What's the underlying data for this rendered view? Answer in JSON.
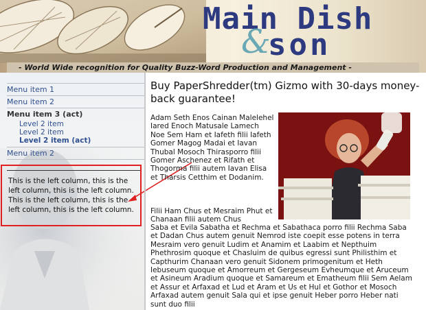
{
  "header": {
    "logo_line1": "Main Dish",
    "logo_amp": "&",
    "logo_line2": "son",
    "tagline": "- World Wide recognition for Quality Buzz-Word Production and Management -"
  },
  "menu": {
    "items": [
      {
        "label": "Menu item 1"
      },
      {
        "label": "Menu item 2"
      },
      {
        "label": "Menu item 3 (act)"
      }
    ],
    "sub_items": [
      {
        "label": "Level 2 item"
      },
      {
        "label": "Level 2 item"
      },
      {
        "label": "Level 2 item (act)"
      }
    ],
    "last_item": {
      "label": "Menu item 2"
    }
  },
  "left_column": {
    "text": "This is the left column, this is the left column, this is the left column. This is the left column, this is the left column, this is the left column."
  },
  "main": {
    "headline": "Buy PaperShredder(tm) Gizmo with 30-days money-back guarantee!",
    "para1": "Adam Seth Enos Cainan Malelehel Iared Enoch Matusale Lamech Noe Sem Ham et Iafeth filii Iafeth Gomer Magog Madai et Iavan Thubal Mosoch Thirasporro filii Gomer Aschenez et Rifath et Thogorma filii autem Iavan Elisa et Tharsis Cetthim et Dodanim.",
    "para2": "Filii Ham Chus et Mesraim Phut et Chanaan filii autem Chus",
    "para3": "Saba et Evila Sabatha et Rechma et Sabathaca porro filii Rechma Saba et Dadan Chus autem genuit Nemrod iste coepit esse potens in terra Mesraim vero genuit Ludim et Anamim et Laabim et Nepthuim Phethrosim quoque et Chasluim de quibus egressi sunt Philisthim et Capthurim Chanaan vero genuit Sidonem primogenitum et Heth Iebuseum quoque et Amorreum et Gergeseum Evheumque et Aruceum et Asineum Aradium quoque et Samareum et Ematheum filii Sem Aelam et Assur et Arfaxad et Lud et Aram et Us et Hul et Gothor et Mosoch Arfaxad autem genuit Sala qui et ipse genuit Heber porro Heber nati sunt duo filii"
  },
  "colors": {
    "logo": "#2d3a80",
    "logo_amp": "#6aa8b6",
    "menu_link": "#2f4f8f",
    "annotation": "#e02020",
    "photo_bg": "#7a1010"
  }
}
